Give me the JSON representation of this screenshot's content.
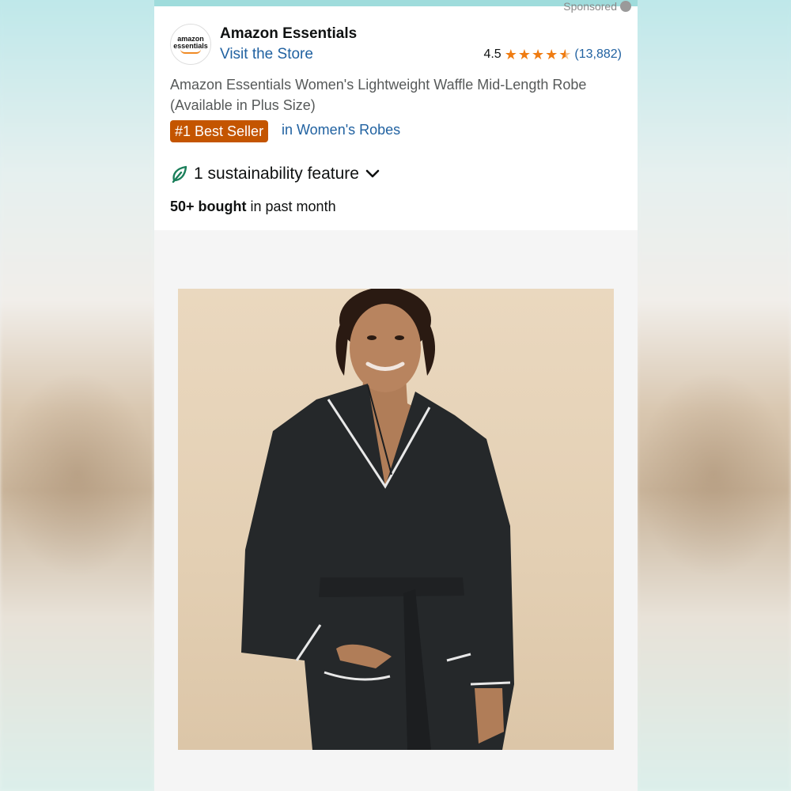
{
  "sponsored_label": "Sponsored",
  "store": {
    "logo_text_line1": "amazon",
    "logo_text_line2": "essentials",
    "name": "Amazon Essentials",
    "link": "Visit the Store"
  },
  "rating": {
    "value": "4.5",
    "stars": 4.5,
    "count": "(13,882)"
  },
  "product": {
    "title": "Amazon Essentials Women's Lightweight Waffle Mid-Length Robe (Available in Plus Size)",
    "badge": "#1 Best Seller",
    "badge_category": "in Women's Robes",
    "sustainability": "1 sustainability feature",
    "bought_bold": "50+ bought",
    "bought_rest": " in past month"
  },
  "colors": {
    "accent_link": "#2162a1",
    "star": "#ef7c12",
    "badge_bg": "#c45500",
    "leaf": "#1a7f5a"
  },
  "icons": [
    "leaf-icon",
    "chevron-down-icon",
    "star-icon",
    "info-icon"
  ]
}
